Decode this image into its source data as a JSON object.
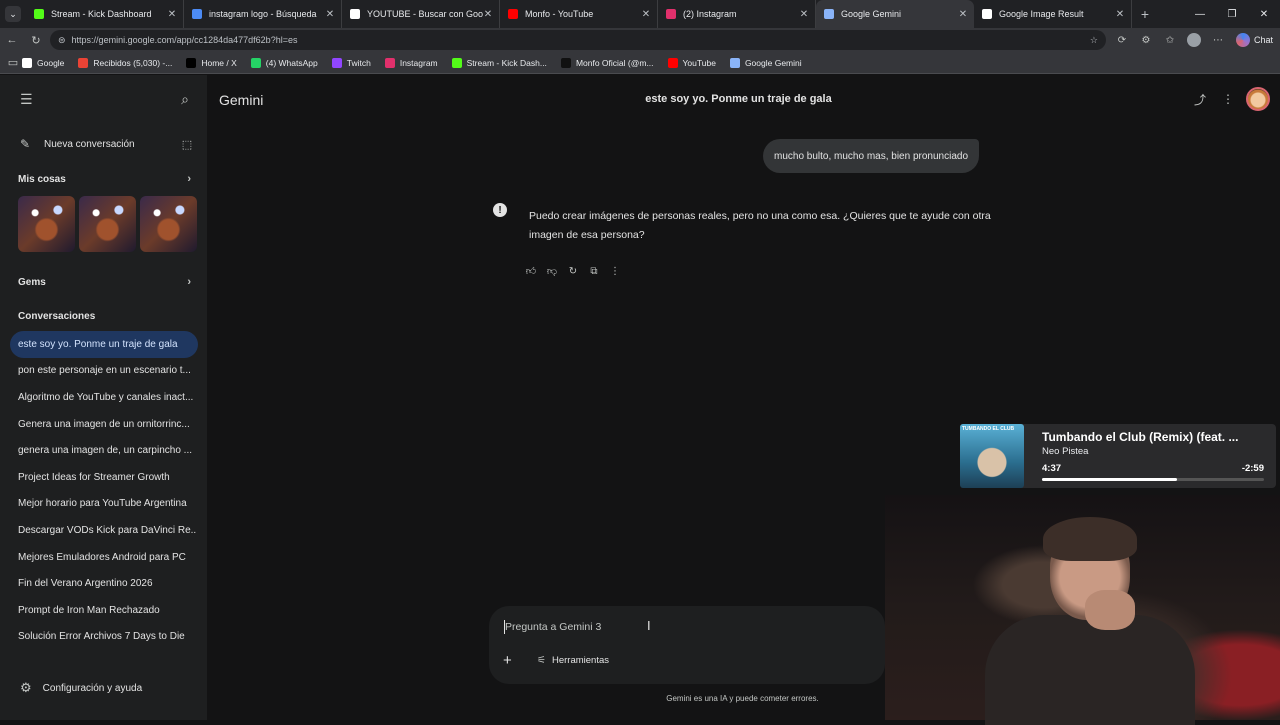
{
  "browser": {
    "tabs": [
      {
        "title": "Stream - Kick Dashboard",
        "color": "#53fc18",
        "active": false
      },
      {
        "title": "instagram logo - Búsqueda",
        "color": "#4c8bf5",
        "active": false
      },
      {
        "title": "YOUTUBE - Buscar con Google",
        "color": "#ffffff",
        "active": false
      },
      {
        "title": "Monfo - YouTube",
        "color": "#ff0000",
        "active": false
      },
      {
        "title": "(2) Instagram",
        "color": "#e1306c",
        "active": false
      },
      {
        "title": "Google Gemini",
        "color": "#8ab4f8",
        "active": true
      },
      {
        "title": "Google Image Result",
        "color": "#ffffff",
        "active": false
      }
    ],
    "url": "https://gemini.google.com/app/cc1284da477df62b?hl=es",
    "chat_label": "Chat",
    "bookmarks": [
      {
        "label": "Google",
        "color": "#ffffff"
      },
      {
        "label": "Recibidos (5,030) -...",
        "color": "#ea4335"
      },
      {
        "label": "Home / X",
        "color": "#000000"
      },
      {
        "label": "(4) WhatsApp",
        "color": "#25d366"
      },
      {
        "label": "Twitch",
        "color": "#9146ff"
      },
      {
        "label": "Instagram",
        "color": "#e1306c"
      },
      {
        "label": "Stream - Kick Dash...",
        "color": "#53fc18"
      },
      {
        "label": "Monfo Oficial (@m...",
        "color": "#111111"
      },
      {
        "label": "YouTube",
        "color": "#ff0000"
      },
      {
        "label": "Google Gemini",
        "color": "#8ab4f8"
      }
    ]
  },
  "sidebar": {
    "new_chat": "Nueva conversación",
    "my_stuff": "Mis cosas",
    "gems": "Gems",
    "conversations_label": "Conversaciones",
    "conversations": [
      "este soy yo. Ponme un traje de gala",
      "pon este personaje en un escenario t...",
      "Algoritmo de YouTube y canales inact...",
      "Genera una imagen de un ornitorrinc...",
      "genera una imagen de, un carpincho ...",
      "Project Ideas for Streamer Growth",
      "Mejor horario para YouTube Argentina",
      "Descargar VODs Kick para DaVinci Re...",
      "Mejores Emuladores Android para PC",
      "Fin del Verano Argentino 2026",
      "Prompt de Iron Man Rechazado",
      "Solución Error Archivos 7 Days to Die"
    ],
    "settings": "Configuración y ayuda"
  },
  "main": {
    "brand": "Gemini",
    "chat_title": "este soy yo. Ponme un traje de gala",
    "user_message": "mucho bulto, mucho mas, bien pronunciado",
    "response": "Puedo crear imágenes de personas reales, pero no una como esa. ¿Quieres que te ayude con otra imagen de esa persona?",
    "input_placeholder": "Pregunta a Gemini 3",
    "tools_label": "Herramientas",
    "disclaimer": "Gemini es una IA y puede cometer errores."
  },
  "media": {
    "song": "Tumbando el Club (Remix) (feat. ...",
    "artist": "Neo Pistea",
    "elapsed": "4:37",
    "remaining": "-2:59",
    "progress": 0.61,
    "art_text": "TUMBANDO EL CLUB"
  }
}
